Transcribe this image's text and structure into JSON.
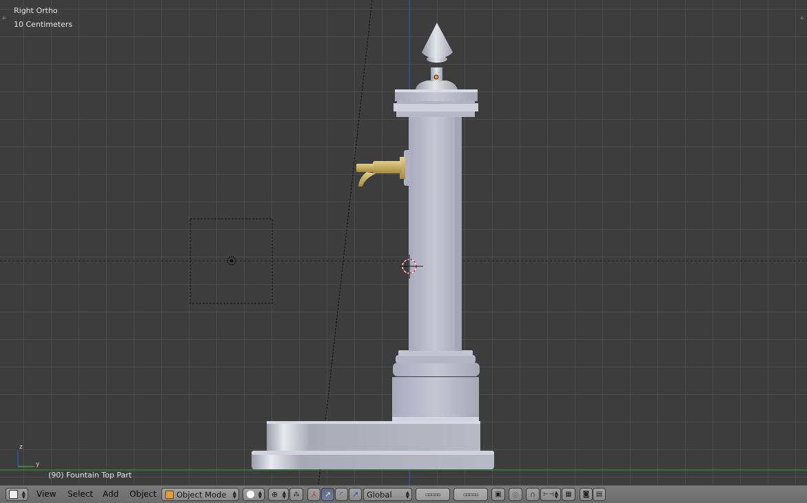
{
  "viewport": {
    "view_name": "Right Ortho",
    "grid_scale": "10 Centimeters",
    "active_object": "(90) Fountain Top Part",
    "axis_z_label": "z",
    "axis_y_label": "y"
  },
  "header": {
    "menus": [
      "View",
      "Select",
      "Add",
      "Object"
    ],
    "mode_label": "Object Mode",
    "transform_orientation": "Global"
  },
  "colors": {
    "viewport_bg": "#3d3d3d",
    "header_bg": "#727272",
    "object_gray": "#c4c4d0",
    "spout_gold": "#c9b06a",
    "axis_green": "#3e9a3e",
    "axis_blue": "#2a4ec0"
  },
  "icons": [
    "editor-type-icon",
    "object-mode-cube-icon",
    "viewport-shading-icon",
    "pivot-icon",
    "manipulator-icon",
    "translate-icon",
    "rotate-icon",
    "scale-icon",
    "layer-icon",
    "lock-icon",
    "proportional-edit-icon",
    "snap-icon",
    "snap-target-icon",
    "render-camera-icon",
    "render-animation-icon"
  ]
}
